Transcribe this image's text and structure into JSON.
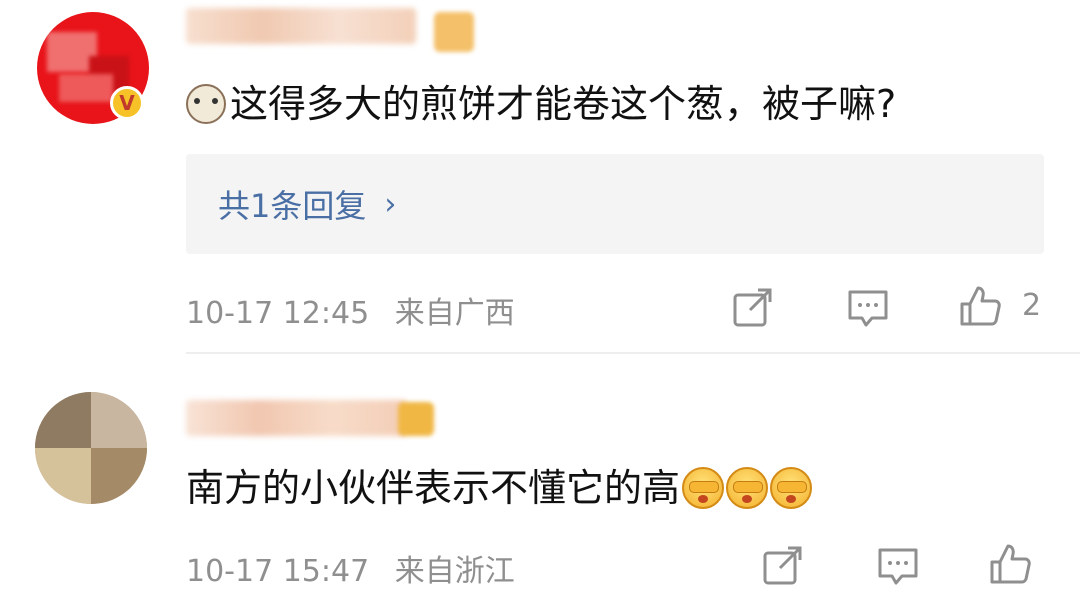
{
  "comments": [
    {
      "text": "这得多大的煎饼才能卷这个葱，被子嘛?",
      "verified_badge": "V",
      "replies_label": "共1条回复",
      "replies_chevron": "›",
      "timestamp": "10-17 12:45",
      "location": "来自广西",
      "like_count": "2",
      "leading_emoji": "cat-emoji"
    },
    {
      "text": "南方的小伙伴表示不懂它的高",
      "timestamp": "10-17 15:47",
      "location": "来自浙江",
      "trailing_emoji": [
        "cover-face-emoji",
        "cover-face-emoji",
        "cover-face-emoji"
      ]
    }
  ],
  "icons": {
    "share": "share-icon",
    "comment": "comment-icon",
    "like": "thumbs-up-icon"
  },
  "colors": {
    "text": "#111111",
    "meta": "#8f8f8f",
    "link": "#4a6fa5",
    "reply_bg": "#f4f4f4",
    "badge": "#f6c227"
  }
}
